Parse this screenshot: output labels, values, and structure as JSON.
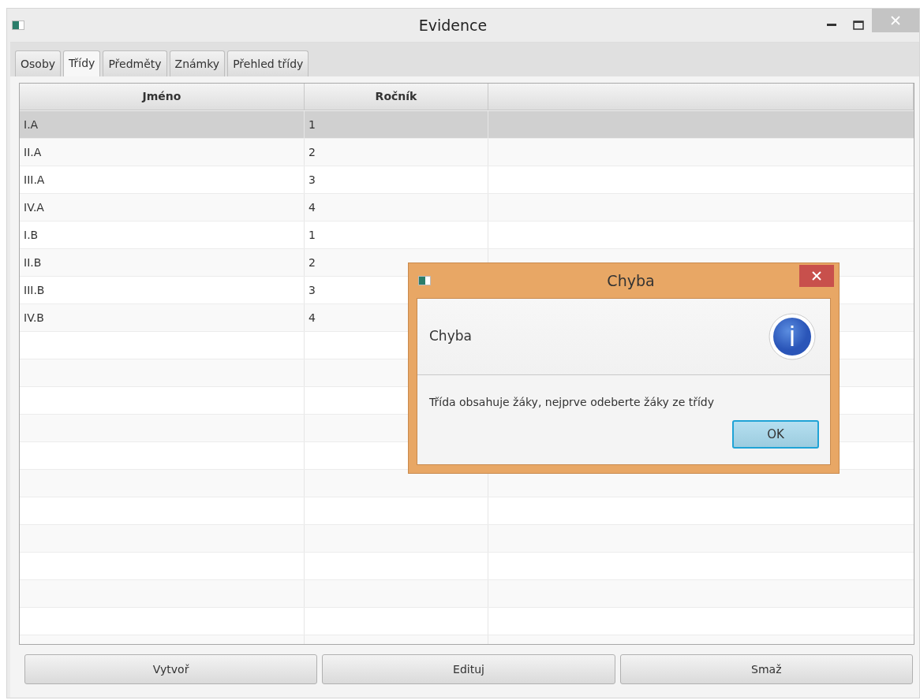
{
  "window": {
    "title": "Evidence"
  },
  "tabs": [
    {
      "label": "Osoby",
      "selected": false
    },
    {
      "label": "Třídy",
      "selected": true
    },
    {
      "label": "Předměty",
      "selected": false
    },
    {
      "label": "Známky",
      "selected": false
    },
    {
      "label": "Přehled třídy",
      "selected": false
    }
  ],
  "table": {
    "columns": [
      "Jméno",
      "Ročník"
    ],
    "rows": [
      {
        "cells": [
          "I.A",
          "1"
        ],
        "selected": true
      },
      {
        "cells": [
          "II.A",
          "2"
        ],
        "selected": false
      },
      {
        "cells": [
          "III.A",
          "3"
        ],
        "selected": false
      },
      {
        "cells": [
          "IV.A",
          "4"
        ],
        "selected": false
      },
      {
        "cells": [
          "I.B",
          "1"
        ],
        "selected": false
      },
      {
        "cells": [
          "II.B",
          "2"
        ],
        "selected": false
      },
      {
        "cells": [
          "III.B",
          "3"
        ],
        "selected": false
      },
      {
        "cells": [
          "IV.B",
          "4"
        ],
        "selected": false
      }
    ]
  },
  "buttons": [
    "Vytvoř",
    "Edituj",
    "Smaž"
  ],
  "dialog": {
    "title": "Chyba",
    "header": "Chyba",
    "message": "Třída obsahuje žáky, nejprve odeberte žáky ze třídy",
    "button": "OK"
  }
}
